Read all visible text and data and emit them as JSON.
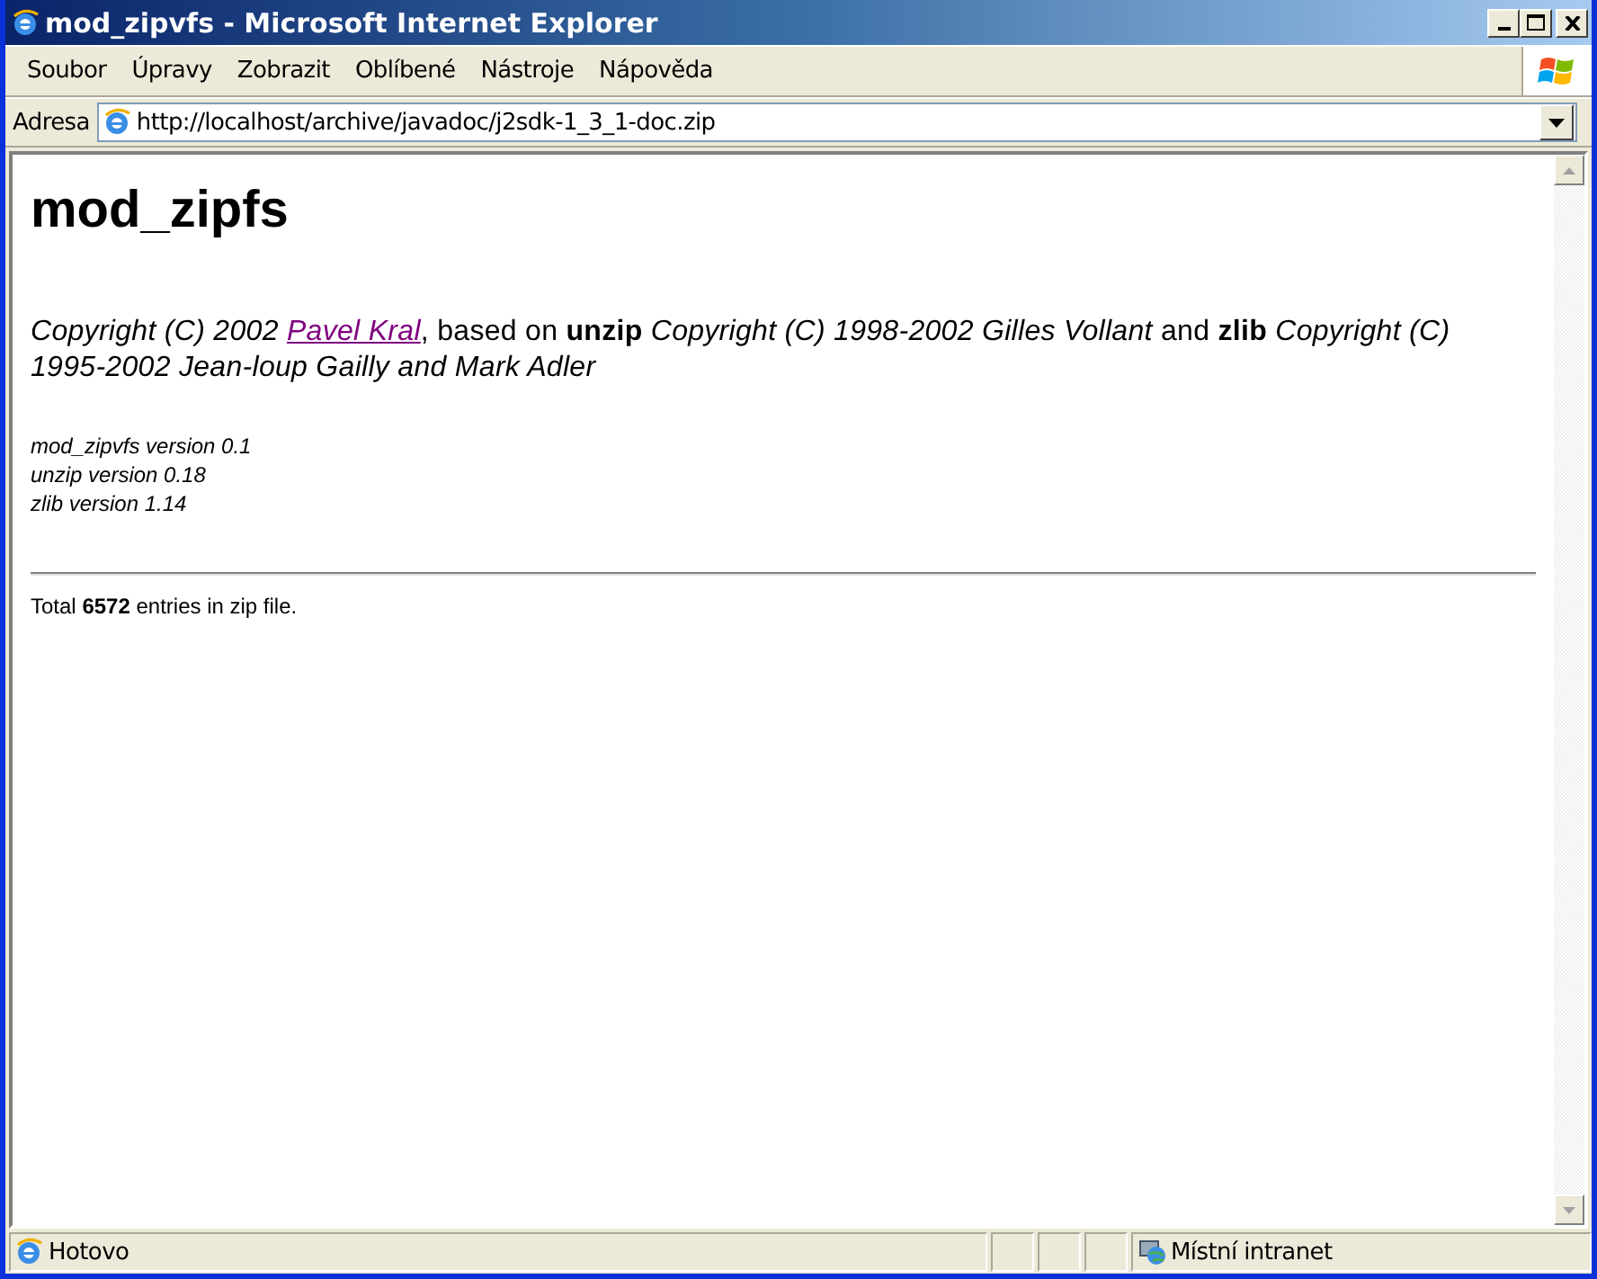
{
  "window": {
    "title": "mod_zipvfs - Microsoft Internet Explorer"
  },
  "menu": [
    "Soubor",
    "Úpravy",
    "Zobrazit",
    "Oblíbené",
    "Nástroje",
    "Nápověda"
  ],
  "address": {
    "label": "Adresa",
    "value": "http://localhost/archive/javadoc/j2sdk-1_3_1-doc.zip"
  },
  "page": {
    "heading": "mod_zipfs",
    "copyright": {
      "before": "Copyright (C) 2002",
      "link": "Pavel Kral",
      "after": ", based on **unzip** *Copyright (C) 1998-2002 Gilles Vollant* and **zlib** *Copyright (C) 1995-2002 Jean-loup Gailly and Mark Adler*"
    },
    "versions": [
      "mod_zipvfs version 0.1",
      "unzip version 0.18",
      "zlib version 1.14"
    ],
    "total": "Total **6572** entries in zip file."
  },
  "status_bar": {
    "text": "Hotovo",
    "zone": "Místní intranet"
  }
}
